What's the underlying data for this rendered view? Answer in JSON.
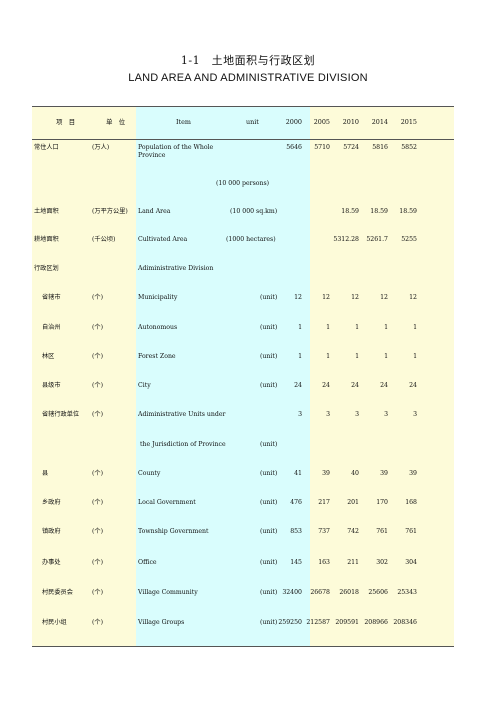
{
  "title_cn": "1-1　土地面积与行政区划",
  "title_en": "LAND AREA AND ADMINISTRATIVE DIVISION",
  "header": {
    "item_cn": "项　目",
    "unit_cn": "单　位",
    "item_en": "Item",
    "unit_en": "unit",
    "years": [
      "2000",
      "2005",
      "2010",
      "2014",
      "2015"
    ]
  },
  "rows": [
    {
      "cn": "常住人口",
      "unit_cn": "(万人)",
      "en": "Population of the Whole",
      "en2": "Province",
      "unit_en": "",
      "values": [
        "5646",
        "5710",
        "5724",
        "5816",
        "5852"
      ]
    },
    {
      "cn": "",
      "unit_cn": "",
      "en": "",
      "en2": "",
      "unit_en": "(10 000 persons)",
      "values": [
        "",
        "",
        "",
        "",
        ""
      ]
    },
    {
      "cn": "土地面积",
      "unit_cn": "(万平方公里)",
      "en": "Land Area",
      "en2": "",
      "unit_en": "(10 000 sq.km)",
      "values": [
        "",
        "",
        "18.59",
        "18.59",
        "18.59"
      ]
    },
    {
      "cn": "耕地面积",
      "unit_cn": "(千公顷)",
      "en": "Cultivated Area",
      "en2": "",
      "unit_en": "(1000 hectares)",
      "values": [
        "",
        "",
        "5312.28",
        "5261.7",
        "5255"
      ]
    },
    {
      "cn": "行政区划",
      "unit_cn": "",
      "en": "Adiministrative Division",
      "en2": "",
      "unit_en": "",
      "values": [
        "",
        "",
        "",
        "",
        ""
      ]
    },
    {
      "cn": "省辖市",
      "unit_cn": "(个)",
      "en": "Municipality",
      "en2": "",
      "unit_en": "(unit)",
      "values": [
        "12",
        "12",
        "12",
        "12",
        "12"
      ]
    },
    {
      "cn": "自治州",
      "unit_cn": "(个)",
      "en": "Autonomous",
      "en2": "",
      "unit_en": "(unit)",
      "values": [
        "1",
        "1",
        "1",
        "1",
        "1"
      ]
    },
    {
      "cn": "林区",
      "unit_cn": "(个)",
      "en": "Forest Zone",
      "en2": "",
      "unit_en": "(unit)",
      "values": [
        "1",
        "1",
        "1",
        "1",
        "1"
      ]
    },
    {
      "cn": "县级市",
      "unit_cn": "(个)",
      "en": "City",
      "en2": "",
      "unit_en": "(unit)",
      "values": [
        "24",
        "24",
        "24",
        "24",
        "24"
      ]
    },
    {
      "cn": "省辖行政单位",
      "unit_cn": "(个)",
      "en": "Adiministrative Units under",
      "en2": "",
      "unit_en": "",
      "values": [
        "3",
        "3",
        "3",
        "3",
        "3"
      ]
    },
    {
      "cn": "",
      "unit_cn": "",
      "en": "the Jurisdiction of Province",
      "en2": "",
      "unit_en": "(unit)",
      "values": [
        "",
        "",
        "",
        "",
        ""
      ]
    },
    {
      "cn": "县",
      "unit_cn": "(个)",
      "en": "County",
      "en2": "",
      "unit_en": "(unit)",
      "values": [
        "41",
        "39",
        "40",
        "39",
        "39"
      ]
    },
    {
      "cn": "乡政府",
      "unit_cn": "(个)",
      "en": "Local Government",
      "en2": "",
      "unit_en": "(unit)",
      "values": [
        "476",
        "217",
        "201",
        "170",
        "168"
      ]
    },
    {
      "cn": "镇政府",
      "unit_cn": "(个)",
      "en": "Township Government",
      "en2": "",
      "unit_en": "(unit)",
      "values": [
        "853",
        "737",
        "742",
        "761",
        "761"
      ]
    },
    {
      "cn": "办事处",
      "unit_cn": "(个)",
      "en": "Office",
      "en2": "",
      "unit_en": "(unit)",
      "values": [
        "145",
        "163",
        "211",
        "302",
        "304"
      ]
    },
    {
      "cn": "村民委员会",
      "unit_cn": "(个)",
      "en": "Village Community",
      "en2": "",
      "unit_en": "(unit)",
      "values": [
        "32400",
        "26678",
        "26018",
        "25606",
        "25343"
      ]
    },
    {
      "cn": "村民小组",
      "unit_cn": "(个)",
      "en": "Village Groups",
      "en2": "",
      "unit_en": "(unit)",
      "values": [
        "259250",
        "212587",
        "209591",
        "208966",
        "208346"
      ]
    }
  ]
}
